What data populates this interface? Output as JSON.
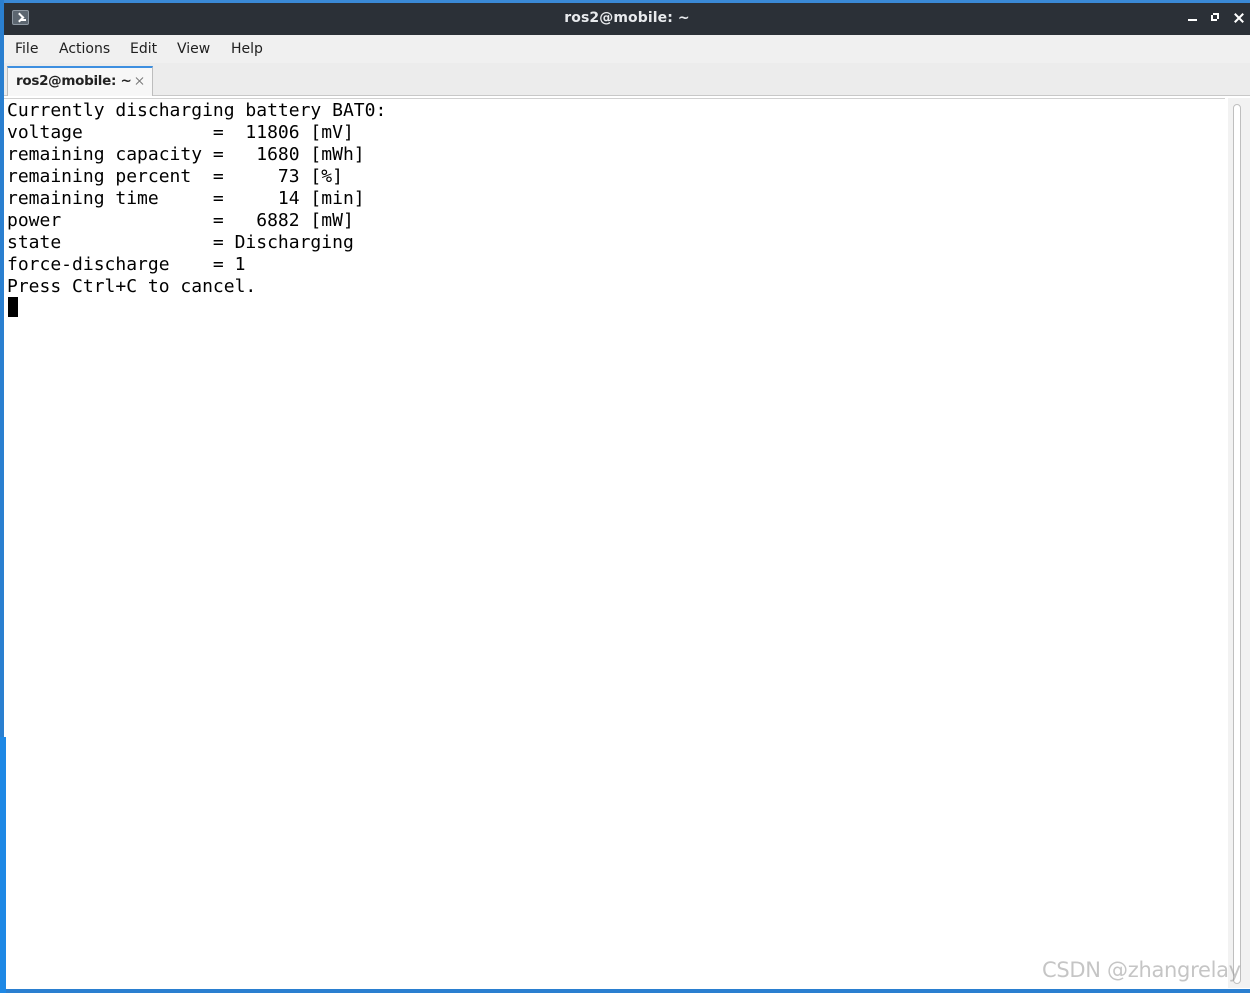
{
  "window": {
    "title": "ros2@mobile: ~"
  },
  "menubar": {
    "items": [
      "File",
      "Actions",
      "Edit",
      "View",
      "Help"
    ]
  },
  "tabs": [
    {
      "label": "ros2@mobile: ~"
    }
  ],
  "terminal": {
    "lines": [
      "Currently discharging battery BAT0:",
      "voltage            =  11806 [mV]",
      "remaining capacity =   1680 [mWh]",
      "remaining percent  =     73 [%]",
      "remaining time     =     14 [min]",
      "power              =   6882 [mW]",
      "state              = Discharging",
      "force-discharge    = 1",
      "Press Ctrl+C to cancel."
    ]
  },
  "watermark": {
    "text": "CSDN @zhangrelay"
  },
  "colors": {
    "titlebar_bg": "#2b3037",
    "window_border": "#2a7fd0",
    "tab_accent": "#3d8fe0",
    "terminal_bg": "#ffffff",
    "terminal_fg": "#000000"
  },
  "icons": {
    "app": "terminal-icon",
    "minimize": "minimize-icon",
    "maximize": "maximize-icon",
    "close": "close-icon",
    "tab_close": "tab-close-icon"
  }
}
